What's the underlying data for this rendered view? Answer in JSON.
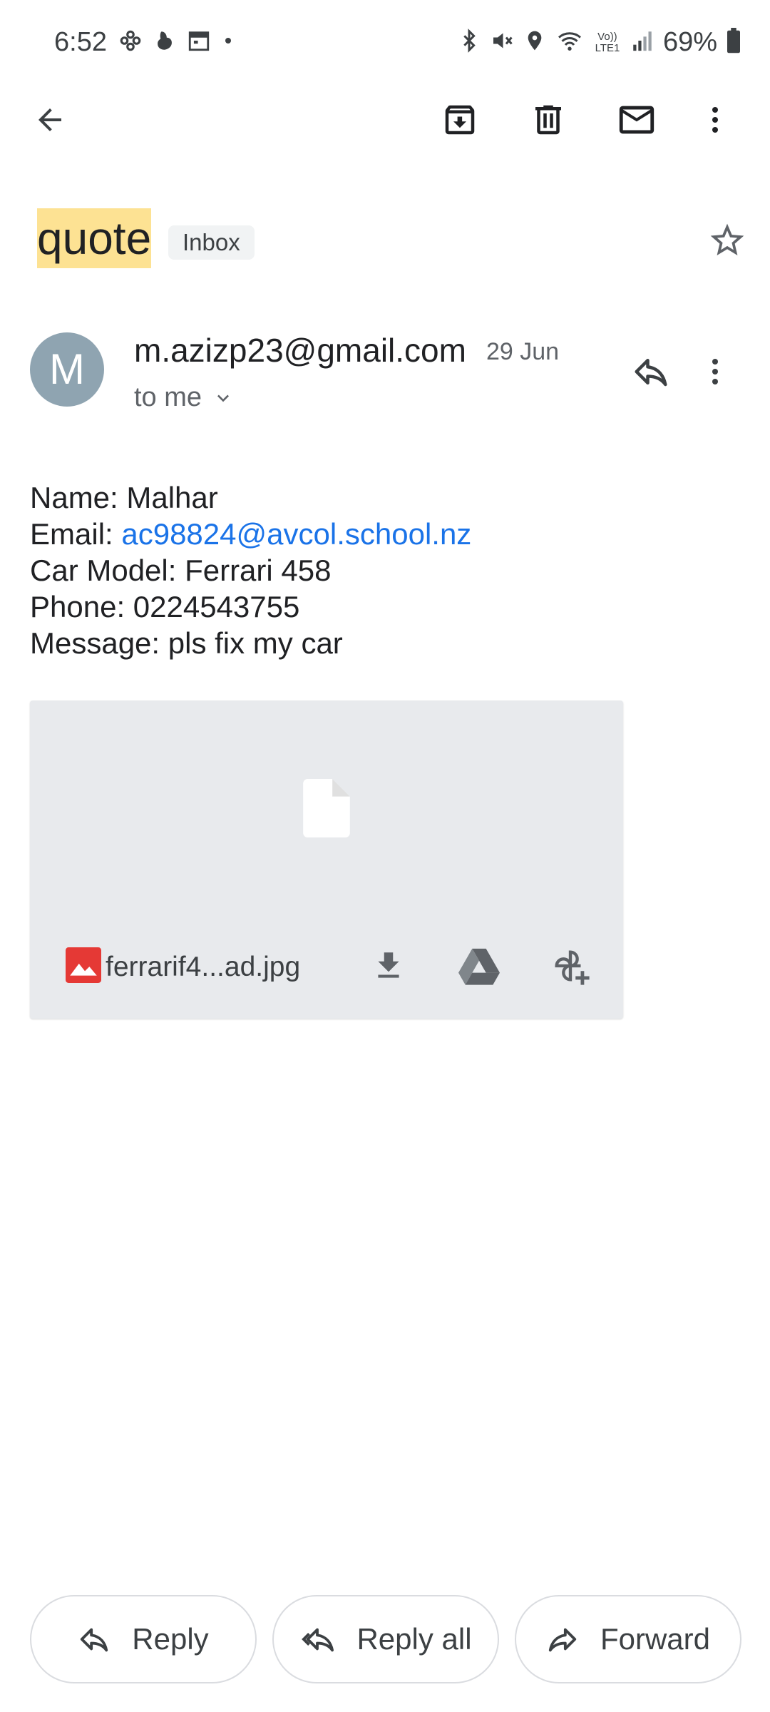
{
  "status_bar": {
    "time": "6:52",
    "battery": "69%",
    "left_icons": [
      "snowflake-icon",
      "weather-icon",
      "calendar-icon",
      "dot-icon"
    ],
    "right_icons": [
      "bluetooth-icon",
      "mute-vibrate-icon",
      "location-icon",
      "wifi-icon",
      "volte-icon",
      "signal-icon",
      "battery-icon"
    ],
    "volte_label": "Vo)) LTE1"
  },
  "toolbar": {
    "back": "back-arrow-icon",
    "actions": [
      "archive-icon",
      "delete-icon",
      "mark-unread-icon",
      "more-vert-icon"
    ]
  },
  "subject": {
    "title": "quote",
    "label": "Inbox"
  },
  "message": {
    "avatar_letter": "M",
    "sender": "m.azizp23@gmail.com",
    "date": "29 Jun",
    "recipient": "to me",
    "body": {
      "name": "Name: Malhar",
      "email_label": "Email: ",
      "email_link": "ac98824@avcol.school.nz",
      "car_model": "Car Model: Ferrari 458",
      "phone": "Phone: 0224543755",
      "message": "Message: pls fix my car"
    }
  },
  "attachment": {
    "filename": "ferrarif4...ad.jpg",
    "type_icon": "image-file-icon",
    "actions": [
      "download-icon",
      "drive-icon",
      "add-to-photos-icon"
    ]
  },
  "actions": {
    "reply": "Reply",
    "reply_all": "Reply all",
    "forward": "Forward"
  },
  "colors": {
    "subject_highlight": "#fde293",
    "link": "#1a73e8",
    "avatar_bg": "#8fa4b1",
    "attachment_bg": "#e8eaed",
    "image_icon": "#e53935"
  }
}
